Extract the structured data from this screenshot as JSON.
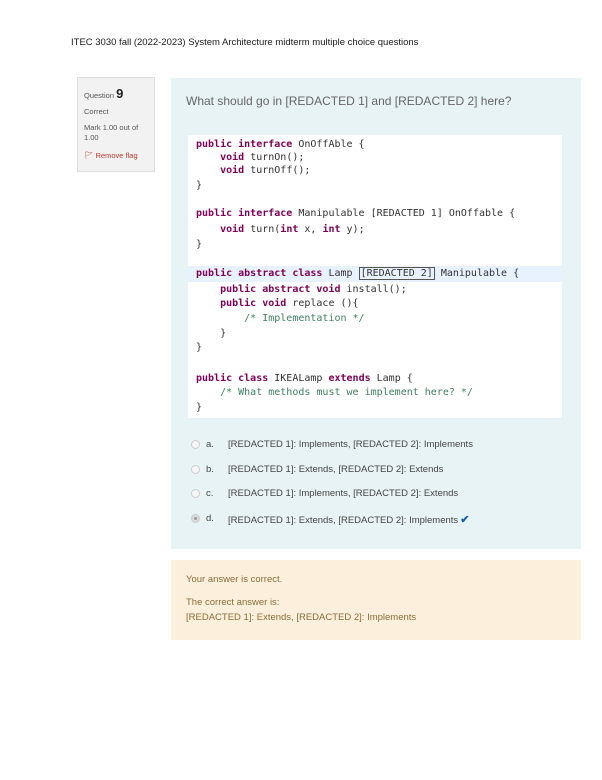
{
  "header": {
    "title": "ITEC 3030 fall (2022-2023) System Architecture midterm multiple choice questions"
  },
  "info": {
    "question_label": "Question",
    "question_number": "9",
    "status": "Correct",
    "mark": "Mark 1.00 out of 1.00",
    "flag_label": "Remove flag"
  },
  "question": {
    "text": "What should go in [REDACTED 1] and [REDACTED 2] here?"
  },
  "code": {
    "l1a": "public interface",
    "l1b": " OnOffAble {",
    "l2a": "    void",
    "l2b": " turnOn();",
    "l3a": "    void",
    "l3b": " turnOff();",
    "l4": "}",
    "l5a": "public interface",
    "l5b": " Manipulable [REDACTED 1] OnOffable {",
    "l6a": "    void",
    "l6b": " turn(",
    "l6c": "int",
    "l6d": " x, ",
    "l6e": "int",
    "l6f": " y);",
    "l7": "}",
    "l8a": "public abstract class",
    "l8b": " Lamp ",
    "l8c": "[REDACTED 2]",
    "l8d": " Manipulable {",
    "l9a": "    public abstract void",
    "l9b": " install();",
    "l10a": "    public void",
    "l10b": " replace (){",
    "l11": "        /* Implementation */",
    "l12": "    }",
    "l13": "}",
    "l14a": "public class",
    "l14b": " IKEALamp ",
    "l14c": "extends",
    "l14d": " Lamp {",
    "l15": "    /* What methods must we implement here? */",
    "l16": "}"
  },
  "options": [
    {
      "letter": "a.",
      "text": "[REDACTED 1]: Implements, [REDACTED 2]: Implements",
      "selected": false
    },
    {
      "letter": "b.",
      "text": "[REDACTED 1]: Extends, [REDACTED 2]: Extends",
      "selected": false
    },
    {
      "letter": "c.",
      "text": "[REDACTED 1]: Implements, [REDACTED 2]: Extends",
      "selected": false
    },
    {
      "letter": "d.",
      "text": "[REDACTED 1]: Extends, [REDACTED 2]: Implements",
      "selected": true
    }
  ],
  "feedback": {
    "result": "Your answer is correct.",
    "label": "The correct answer is:",
    "answer": "[REDACTED 1]: Extends, [REDACTED 2]: Implements"
  }
}
